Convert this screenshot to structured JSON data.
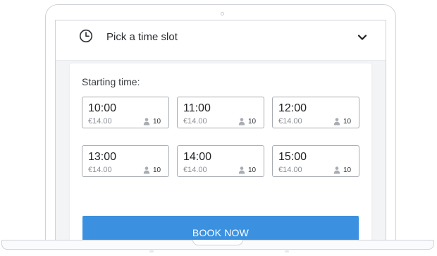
{
  "header": {
    "title": "Pick a time slot",
    "leading_icon": "clock-icon",
    "trailing_icon": "chevron-down-icon"
  },
  "booking": {
    "starting_label": "Starting time:",
    "slots": [
      {
        "time": "10:00",
        "price": "€14.00",
        "capacity": "10"
      },
      {
        "time": "11:00",
        "price": "€14.00",
        "capacity": "10"
      },
      {
        "time": "12:00",
        "price": "€14.00",
        "capacity": "10"
      },
      {
        "time": "13:00",
        "price": "€14.00",
        "capacity": "10"
      },
      {
        "time": "14:00",
        "price": "€14.00",
        "capacity": "10"
      },
      {
        "time": "15:00",
        "price": "€14.00",
        "capacity": "10"
      }
    ],
    "book_label": "BOOK NOW"
  },
  "colors": {
    "accent": "#3b91e0",
    "slot_border": "#a7abb1",
    "background": "#f3f4f6"
  }
}
